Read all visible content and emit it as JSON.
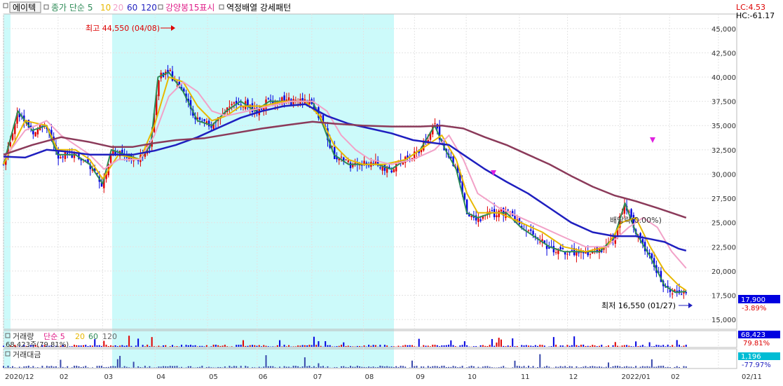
{
  "header": {
    "stock_name": "에이텍",
    "ma_label": "종가 단순",
    "ma_periods": [
      "5",
      "10",
      "20",
      "60",
      "120"
    ],
    "ma_colors": [
      "#2e8b57",
      "#e8b800",
      "#f2a2c8",
      "#1f1fbf",
      "#8b3a5a"
    ],
    "strong_label": "강양봉15표시",
    "pattern_label": "역정배열 강세패턴",
    "lc": "LC:4.53",
    "hc": "HC:-61.17"
  },
  "annotations": {
    "high": "최고 44,550 (04/08)",
    "low": "최저 16,550 (01/27)",
    "dividend": "배당락(0.00%)"
  },
  "price_badge": {
    "value": "17,900",
    "change": "-3.89%"
  },
  "volume_panel": {
    "label": "거래량",
    "ma_label": "단순",
    "ma_periods": [
      "5",
      "20",
      "60",
      "120"
    ],
    "current": "68,423",
    "change": "79.81%",
    "left_value": "68,423주(79.81%)"
  },
  "amount_panel": {
    "label": "거래대금",
    "current": "1,196",
    "change": "-77.97%"
  },
  "chart_data": {
    "type": "candlestick",
    "y_ticks": [
      "15,000",
      "17,500",
      "20,000",
      "22,500",
      "25,000",
      "27,500",
      "30,000",
      "32,500",
      "35,000",
      "37,500",
      "40,000",
      "42,500",
      "45,000"
    ],
    "y_values": [
      15000,
      17500,
      20000,
      22500,
      25000,
      27500,
      30000,
      32500,
      35000,
      37500,
      40000,
      42500,
      45000
    ],
    "ylim": [
      14000,
      46500
    ],
    "x_labels": [
      "2020/12",
      "02",
      "03",
      "04",
      "05",
      "06",
      "07",
      "08",
      "09",
      "10",
      "11",
      "12",
      "2022/01",
      "02",
      "02/11"
    ],
    "x_positions": [
      0.0,
      0.076,
      0.138,
      0.211,
      0.284,
      0.353,
      0.429,
      0.501,
      0.572,
      0.644,
      0.718,
      0.785,
      0.858,
      0.927,
      0.995
    ],
    "series": [
      {
        "name": "5",
        "points": [
          [
            0.0,
            31000
          ],
          [
            0.02,
            36500
          ],
          [
            0.04,
            34500
          ],
          [
            0.06,
            35000
          ],
          [
            0.075,
            32000
          ],
          [
            0.1,
            32000
          ],
          [
            0.12,
            31000
          ],
          [
            0.138,
            29000
          ],
          [
            0.15,
            32500
          ],
          [
            0.17,
            32000
          ],
          [
            0.19,
            31500
          ],
          [
            0.205,
            33000
          ],
          [
            0.215,
            40000
          ],
          [
            0.23,
            40500
          ],
          [
            0.25,
            38500
          ],
          [
            0.27,
            35500
          ],
          [
            0.29,
            35000
          ],
          [
            0.31,
            36500
          ],
          [
            0.33,
            37500
          ],
          [
            0.35,
            36500
          ],
          [
            0.37,
            37500
          ],
          [
            0.39,
            37500
          ],
          [
            0.41,
            37500
          ],
          [
            0.43,
            37500
          ],
          [
            0.445,
            35000
          ],
          [
            0.46,
            32000
          ],
          [
            0.48,
            31000
          ],
          [
            0.5,
            31000
          ],
          [
            0.52,
            31000
          ],
          [
            0.54,
            30500
          ],
          [
            0.56,
            31500
          ],
          [
            0.58,
            32500
          ],
          [
            0.6,
            35000
          ],
          [
            0.615,
            32500
          ],
          [
            0.63,
            30500
          ],
          [
            0.645,
            26000
          ],
          [
            0.66,
            25500
          ],
          [
            0.68,
            26000
          ],
          [
            0.7,
            26000
          ],
          [
            0.72,
            24500
          ],
          [
            0.74,
            23500
          ],
          [
            0.76,
            22500
          ],
          [
            0.78,
            22000
          ],
          [
            0.8,
            22000
          ],
          [
            0.83,
            22000
          ],
          [
            0.85,
            23500
          ],
          [
            0.865,
            27000
          ],
          [
            0.88,
            24000
          ],
          [
            0.9,
            21500
          ],
          [
            0.92,
            18500
          ],
          [
            0.935,
            17800
          ],
          [
            0.95,
            17900
          ]
        ]
      },
      {
        "name": "10",
        "points": [
          [
            0.0,
            31000
          ],
          [
            0.03,
            35500
          ],
          [
            0.06,
            35000
          ],
          [
            0.075,
            32500
          ],
          [
            0.1,
            32500
          ],
          [
            0.12,
            31500
          ],
          [
            0.138,
            29500
          ],
          [
            0.16,
            32000
          ],
          [
            0.19,
            31500
          ],
          [
            0.21,
            35000
          ],
          [
            0.23,
            40000
          ],
          [
            0.25,
            39500
          ],
          [
            0.27,
            37000
          ],
          [
            0.29,
            35500
          ],
          [
            0.31,
            36000
          ],
          [
            0.33,
            37000
          ],
          [
            0.36,
            37000
          ],
          [
            0.39,
            37500
          ],
          [
            0.42,
            37500
          ],
          [
            0.44,
            36000
          ],
          [
            0.46,
            33000
          ],
          [
            0.48,
            31500
          ],
          [
            0.5,
            31000
          ],
          [
            0.53,
            31000
          ],
          [
            0.56,
            31500
          ],
          [
            0.59,
            33000
          ],
          [
            0.61,
            34000
          ],
          [
            0.63,
            31500
          ],
          [
            0.645,
            28000
          ],
          [
            0.66,
            26000
          ],
          [
            0.69,
            26000
          ],
          [
            0.72,
            25000
          ],
          [
            0.75,
            24000
          ],
          [
            0.78,
            22500
          ],
          [
            0.81,
            22000
          ],
          [
            0.84,
            22500
          ],
          [
            0.86,
            25000
          ],
          [
            0.88,
            25500
          ],
          [
            0.9,
            22500
          ],
          [
            0.92,
            20000
          ],
          [
            0.94,
            18500
          ],
          [
            0.95,
            18000
          ]
        ]
      },
      {
        "name": "20",
        "points": [
          [
            0.0,
            31500
          ],
          [
            0.03,
            34500
          ],
          [
            0.06,
            35500
          ],
          [
            0.08,
            34000
          ],
          [
            0.1,
            33000
          ],
          [
            0.12,
            32000
          ],
          [
            0.14,
            30500
          ],
          [
            0.16,
            31500
          ],
          [
            0.19,
            31500
          ],
          [
            0.21,
            34000
          ],
          [
            0.23,
            38000
          ],
          [
            0.25,
            39500
          ],
          [
            0.27,
            38500
          ],
          [
            0.29,
            36500
          ],
          [
            0.31,
            36000
          ],
          [
            0.34,
            36500
          ],
          [
            0.37,
            37000
          ],
          [
            0.4,
            37500
          ],
          [
            0.43,
            37500
          ],
          [
            0.45,
            36500
          ],
          [
            0.47,
            34000
          ],
          [
            0.49,
            32500
          ],
          [
            0.51,
            31500
          ],
          [
            0.54,
            31000
          ],
          [
            0.57,
            31500
          ],
          [
            0.6,
            32500
          ],
          [
            0.62,
            34000
          ],
          [
            0.64,
            31500
          ],
          [
            0.66,
            28000
          ],
          [
            0.69,
            26500
          ],
          [
            0.72,
            25500
          ],
          [
            0.75,
            24500
          ],
          [
            0.78,
            23500
          ],
          [
            0.81,
            22500
          ],
          [
            0.84,
            22500
          ],
          [
            0.87,
            24500
          ],
          [
            0.89,
            25500
          ],
          [
            0.91,
            24500
          ],
          [
            0.93,
            22000
          ],
          [
            0.95,
            20300
          ]
        ]
      },
      {
        "name": "60",
        "points": [
          [
            0.0,
            31800
          ],
          [
            0.03,
            31700
          ],
          [
            0.06,
            32500
          ],
          [
            0.09,
            32300
          ],
          [
            0.12,
            32000
          ],
          [
            0.15,
            32000
          ],
          [
            0.18,
            32000
          ],
          [
            0.21,
            32400
          ],
          [
            0.24,
            33000
          ],
          [
            0.27,
            33800
          ],
          [
            0.3,
            34800
          ],
          [
            0.33,
            35800
          ],
          [
            0.36,
            36500
          ],
          [
            0.39,
            37000
          ],
          [
            0.42,
            37200
          ],
          [
            0.45,
            36000
          ],
          [
            0.48,
            35200
          ],
          [
            0.51,
            34700
          ],
          [
            0.54,
            34200
          ],
          [
            0.57,
            33500
          ],
          [
            0.6,
            33200
          ],
          [
            0.62,
            33000
          ],
          [
            0.64,
            32000
          ],
          [
            0.67,
            30500
          ],
          [
            0.7,
            29200
          ],
          [
            0.73,
            28000
          ],
          [
            0.76,
            26500
          ],
          [
            0.79,
            25000
          ],
          [
            0.82,
            24000
          ],
          [
            0.85,
            23600
          ],
          [
            0.88,
            23600
          ],
          [
            0.9,
            23300
          ],
          [
            0.92,
            23000
          ],
          [
            0.94,
            22300
          ],
          [
            0.95,
            22100
          ]
        ]
      },
      {
        "name": "120",
        "points": [
          [
            0.0,
            32000
          ],
          [
            0.04,
            33000
          ],
          [
            0.08,
            33800
          ],
          [
            0.12,
            33300
          ],
          [
            0.15,
            32800
          ],
          [
            0.18,
            32800
          ],
          [
            0.21,
            33200
          ],
          [
            0.24,
            33500
          ],
          [
            0.28,
            33700
          ],
          [
            0.32,
            34200
          ],
          [
            0.36,
            34700
          ],
          [
            0.4,
            35100
          ],
          [
            0.43,
            35400
          ],
          [
            0.46,
            35200
          ],
          [
            0.5,
            35000
          ],
          [
            0.54,
            34900
          ],
          [
            0.58,
            34900
          ],
          [
            0.61,
            35000
          ],
          [
            0.64,
            34700
          ],
          [
            0.67,
            33800
          ],
          [
            0.7,
            33000
          ],
          [
            0.73,
            32000
          ],
          [
            0.76,
            31000
          ],
          [
            0.79,
            29800
          ],
          [
            0.82,
            28700
          ],
          [
            0.85,
            27800
          ],
          [
            0.88,
            27200
          ],
          [
            0.91,
            26500
          ],
          [
            0.93,
            26000
          ],
          [
            0.95,
            25500
          ]
        ]
      }
    ]
  }
}
